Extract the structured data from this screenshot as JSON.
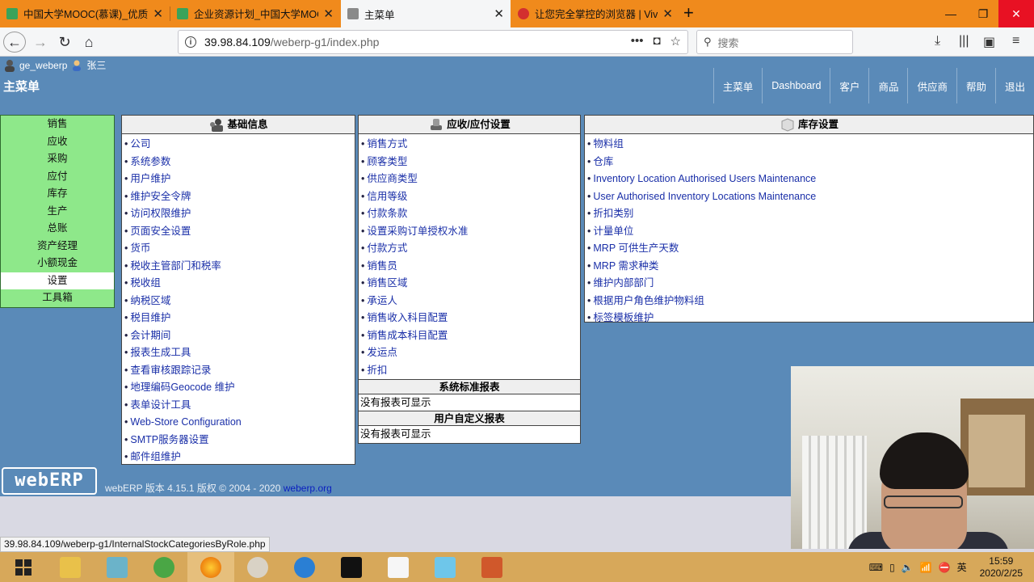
{
  "browser": {
    "tabs": [
      {
        "title": "中国大学MOOC(慕课)_优质在线",
        "active": false
      },
      {
        "title": "企业资源计划_中国大学MOOC",
        "active": false
      },
      {
        "title": "主菜单",
        "active": true
      },
      {
        "title": "让您完全掌控的浏览器 | Vivaldi",
        "active": false
      }
    ],
    "url_host": "39.98.84.109",
    "url_path": "/weberp-g1/index.php",
    "search_placeholder": "搜索",
    "status_url": "39.98.84.109/weberp-g1/InternalStockCategoriesByRole.php"
  },
  "app": {
    "company_user": "ge_weberp",
    "user_name": "张三",
    "title": "主菜单",
    "top_menu": [
      "主菜单",
      "Dashboard",
      "客户",
      "商品",
      "供应商",
      "帮助",
      "退出"
    ],
    "left_menu": [
      "销售",
      "应收",
      "采购",
      "应付",
      "库存",
      "生产",
      "总账",
      "资产经理",
      "小额现金",
      "设置",
      "工具箱"
    ],
    "left_menu_selected": "设置",
    "panels": {
      "basic": {
        "title": "基础信息",
        "items": [
          "公司",
          "系统参数",
          "用户维护",
          "维护安全令牌",
          "访问权限维护",
          "页面安全设置",
          "货币",
          "税收主管部门和税率",
          "税收组",
          "纳税区域",
          "税目维护",
          "会计期间",
          "报表生成工具",
          "查看审核跟踪记录",
          "地理编码Geocode 维护",
          "表单设计工具",
          "Web-Store Configuration",
          "SMTP服务器设置",
          "邮件组维护"
        ]
      },
      "arap": {
        "title": "应收/应付设置",
        "items": [
          "销售方式",
          "顾客类型",
          "供应商类型",
          "信用等级",
          "付款条款",
          "设置采购订单授权水准",
          "付款方式",
          "销售员",
          "销售区域",
          "承运人",
          "销售收入科目配置",
          "销售成本科目配置",
          "发运点",
          "折扣"
        ],
        "std_reports_title": "系统标准报表",
        "std_reports_empty": "没有报表可显示",
        "user_reports_title": "用户自定义报表",
        "user_reports_empty": "没有报表可显示"
      },
      "inventory": {
        "title": "库存设置",
        "items": [
          "物料组",
          "仓库",
          "Inventory Location Authorised Users Maintenance",
          "User Authorised Inventory Locations Maintenance",
          "折扣类别",
          "计量单位",
          "MRP 可供生产天数",
          "MRP 需求种类",
          "维护内部部门",
          "根据用户角色维护物料组",
          "标签模板维护"
        ]
      }
    },
    "logo_text": "webERP",
    "footer_text": "webERP 版本 4.15.1 版权 © 2004 - 2020",
    "footer_link": "weberp.org"
  },
  "taskbar": {
    "tray_lang": "英",
    "time": "15:59",
    "date": "2020/2/25"
  },
  "colors": {
    "app_bg": "#5a8ab8",
    "menu_green": "#8ee88a",
    "tab_strip": "#f08a1c",
    "link": "#1a2fa8"
  }
}
